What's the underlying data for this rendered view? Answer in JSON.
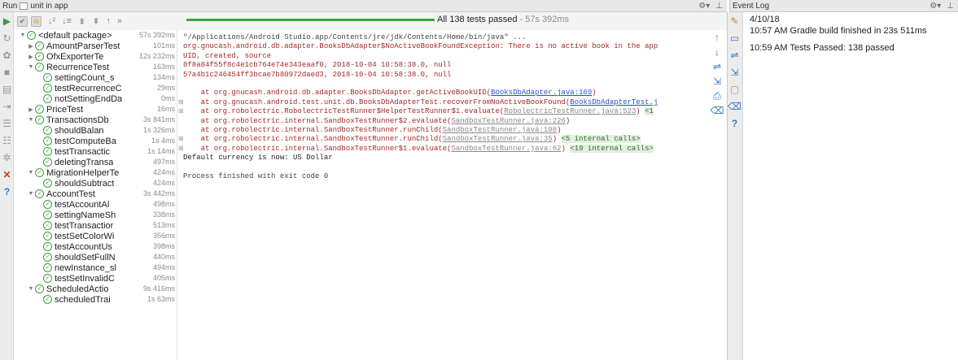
{
  "run_header": {
    "run_label": "Run",
    "config": "unit in app"
  },
  "event_header": {
    "title": "Event Log"
  },
  "status": {
    "passed": "All 138 tests passed",
    "duration": "- 57s 392ms",
    "progress": 1.0
  },
  "tree": [
    {
      "level": 0,
      "arrow": "▼",
      "name": "<default package>",
      "duration": "57s 392ms",
      "bold": true
    },
    {
      "level": 1,
      "arrow": "▶",
      "name": "AmountParserTest",
      "duration": "101ms"
    },
    {
      "level": 1,
      "arrow": "▶",
      "name": "OfxExporterTe",
      "duration": "12s 232ms"
    },
    {
      "level": 1,
      "arrow": "▼",
      "name": "RecurrenceTest",
      "duration": "163ms"
    },
    {
      "level": 2,
      "arrow": "",
      "name": "settingCount_s",
      "duration": "134ms"
    },
    {
      "level": 2,
      "arrow": "",
      "name": "testRecurrenceC",
      "duration": "29ms"
    },
    {
      "level": 2,
      "arrow": "",
      "name": "notSettingEndDa",
      "duration": "0ms"
    },
    {
      "level": 1,
      "arrow": "▶",
      "name": "PriceTest",
      "duration": "16ms"
    },
    {
      "level": 1,
      "arrow": "▼",
      "name": "TransactionsDb",
      "duration": "3s 841ms"
    },
    {
      "level": 2,
      "arrow": "",
      "name": "shouldBalan",
      "duration": "1s 326ms"
    },
    {
      "level": 2,
      "arrow": "",
      "name": "testComputeBa",
      "duration": "1s 4ms"
    },
    {
      "level": 2,
      "arrow": "",
      "name": "testTransactic",
      "duration": "1s 14ms"
    },
    {
      "level": 2,
      "arrow": "",
      "name": "deletingTransa",
      "duration": "497ms"
    },
    {
      "level": 1,
      "arrow": "▼",
      "name": "MigrationHelperTe",
      "duration": "424ms"
    },
    {
      "level": 2,
      "arrow": "",
      "name": "shouldSubtract",
      "duration": "424ms"
    },
    {
      "level": 1,
      "arrow": "▼",
      "name": "AccountTest",
      "duration": "3s 442ms"
    },
    {
      "level": 2,
      "arrow": "",
      "name": "testAccountAl",
      "duration": "498ms"
    },
    {
      "level": 2,
      "arrow": "",
      "name": "settingNameSh",
      "duration": "338ms"
    },
    {
      "level": 2,
      "arrow": "",
      "name": "testTransactior",
      "duration": "513ms"
    },
    {
      "level": 2,
      "arrow": "",
      "name": "testSetColorWi",
      "duration": "356ms"
    },
    {
      "level": 2,
      "arrow": "",
      "name": "testAccountUs",
      "duration": "398ms"
    },
    {
      "level": 2,
      "arrow": "",
      "name": "shouldSetFullN",
      "duration": "440ms"
    },
    {
      "level": 2,
      "arrow": "",
      "name": "newInstance_sl",
      "duration": "494ms"
    },
    {
      "level": 2,
      "arrow": "",
      "name": "testSetInvalidC",
      "duration": "405ms"
    },
    {
      "level": 1,
      "arrow": "▼",
      "name": "ScheduledActio",
      "duration": "9s 416ms"
    },
    {
      "level": 2,
      "arrow": "",
      "name": "scheduledTrai",
      "duration": "1s 63ms"
    }
  ],
  "console": [
    {
      "type": "cmd",
      "parts": [
        {
          "t": "\"/Applications/Android Studio.app/Contents/jre/jdk/Contents/Home/bin/java\" ..."
        }
      ]
    },
    {
      "type": "err",
      "parts": [
        {
          "t": "org.gnucash.android.db.adapter.BooksDbAdapter$NoActiveBookFoundException: There is no active book in the app"
        }
      ]
    },
    {
      "type": "err",
      "parts": [
        {
          "t": "UID, created, source"
        }
      ]
    },
    {
      "type": "err",
      "parts": [
        {
          "t": "8f8a84f55f8c4e1cb764e74e343eaaf0, 2018-10-04 10:58:38.0, null"
        }
      ]
    },
    {
      "type": "err",
      "parts": [
        {
          "t": "57a4b1c246454ff3bcae7b80972daed3, 2018-10-04 10:58:38.0, null"
        }
      ]
    },
    {
      "type": "blank",
      "parts": [
        {
          "t": ""
        }
      ]
    },
    {
      "type": "err",
      "parts": [
        {
          "t": "    at org.gnucash.android.db.adapter.BooksDbAdapter.getActiveBookUID("
        },
        {
          "t": "BooksDbAdapter.java:169",
          "link": true
        },
        {
          "t": ")"
        }
      ]
    },
    {
      "type": "err",
      "fold": true,
      "parts": [
        {
          "t": "    at org.gnucash.android.test.unit.db.BooksDbAdapterTest.recoverFromNoActiveBookFound("
        },
        {
          "t": "BooksDbAdapterTest.j",
          "link": true
        }
      ]
    },
    {
      "type": "err",
      "fold": true,
      "parts": [
        {
          "t": "    at org.robolectric.RobolectricTestRunner$HelperTestRunner$1.evaluate("
        },
        {
          "t": "RobolectricTestRunner.java:523",
          "link": true,
          "grey": true
        },
        {
          "t": ") "
        },
        {
          "t": "<1",
          "call": true
        }
      ]
    },
    {
      "type": "err",
      "parts": [
        {
          "t": "    at org.robolectric.internal.SandboxTestRunner$2.evaluate("
        },
        {
          "t": "SandboxTestRunner.java:226",
          "link": true,
          "grey": true
        },
        {
          "t": ")"
        }
      ]
    },
    {
      "type": "err",
      "parts": [
        {
          "t": "    at org.robolectric.internal.SandboxTestRunner.runChild("
        },
        {
          "t": "SandboxTestRunner.java:108",
          "link": true,
          "grey": true
        },
        {
          "t": ")"
        }
      ]
    },
    {
      "type": "err",
      "fold": true,
      "parts": [
        {
          "t": "    at org.robolectric.internal.SandboxTestRunner.runChild("
        },
        {
          "t": "SandboxTestRunner.java:35",
          "link": true,
          "grey": true
        },
        {
          "t": ") "
        },
        {
          "t": "<5 internal calls>",
          "call": true
        }
      ]
    },
    {
      "type": "err",
      "fold": true,
      "parts": [
        {
          "t": "    at org.robolectric.internal.SandboxTestRunner$1.evaluate("
        },
        {
          "t": "SandboxTestRunner.java:62",
          "link": true,
          "grey": true
        },
        {
          "t": ") "
        },
        {
          "t": "<19 internal calls>",
          "call": true
        }
      ]
    },
    {
      "type": "out",
      "parts": [
        {
          "t": "Default currency is now: US Dollar"
        }
      ]
    },
    {
      "type": "blank",
      "parts": [
        {
          "t": ""
        }
      ]
    },
    {
      "type": "cmd",
      "parts": [
        {
          "t": "Process finished with exit code 0"
        }
      ]
    }
  ],
  "event_log": {
    "date": "4/10/18",
    "entries": [
      "10:57 AM Gradle build finished in 23s 511ms",
      "10:59 AM Tests Passed: 138 passed"
    ]
  }
}
